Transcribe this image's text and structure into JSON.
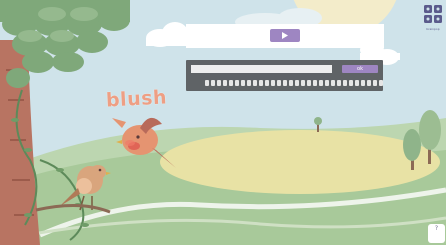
{
  "vocab": {
    "word": "blush"
  },
  "top_panel": {
    "play_icon": "play-icon"
  },
  "answer": {
    "input_value": "",
    "ok_label": "ok",
    "keys": 30
  },
  "brand": {
    "logo_icon": "grid-logo-icon",
    "logo_text": "brainpop"
  },
  "help": {
    "label": "?"
  },
  "colors": {
    "sky": "#cfe3ea",
    "hill": "#a8c99a",
    "path": "#e8e2a5",
    "tree_trunk": "#b87462",
    "leaf": "#7fa87a",
    "accent_purple": "#9e86c2",
    "bird": "#e59471"
  }
}
